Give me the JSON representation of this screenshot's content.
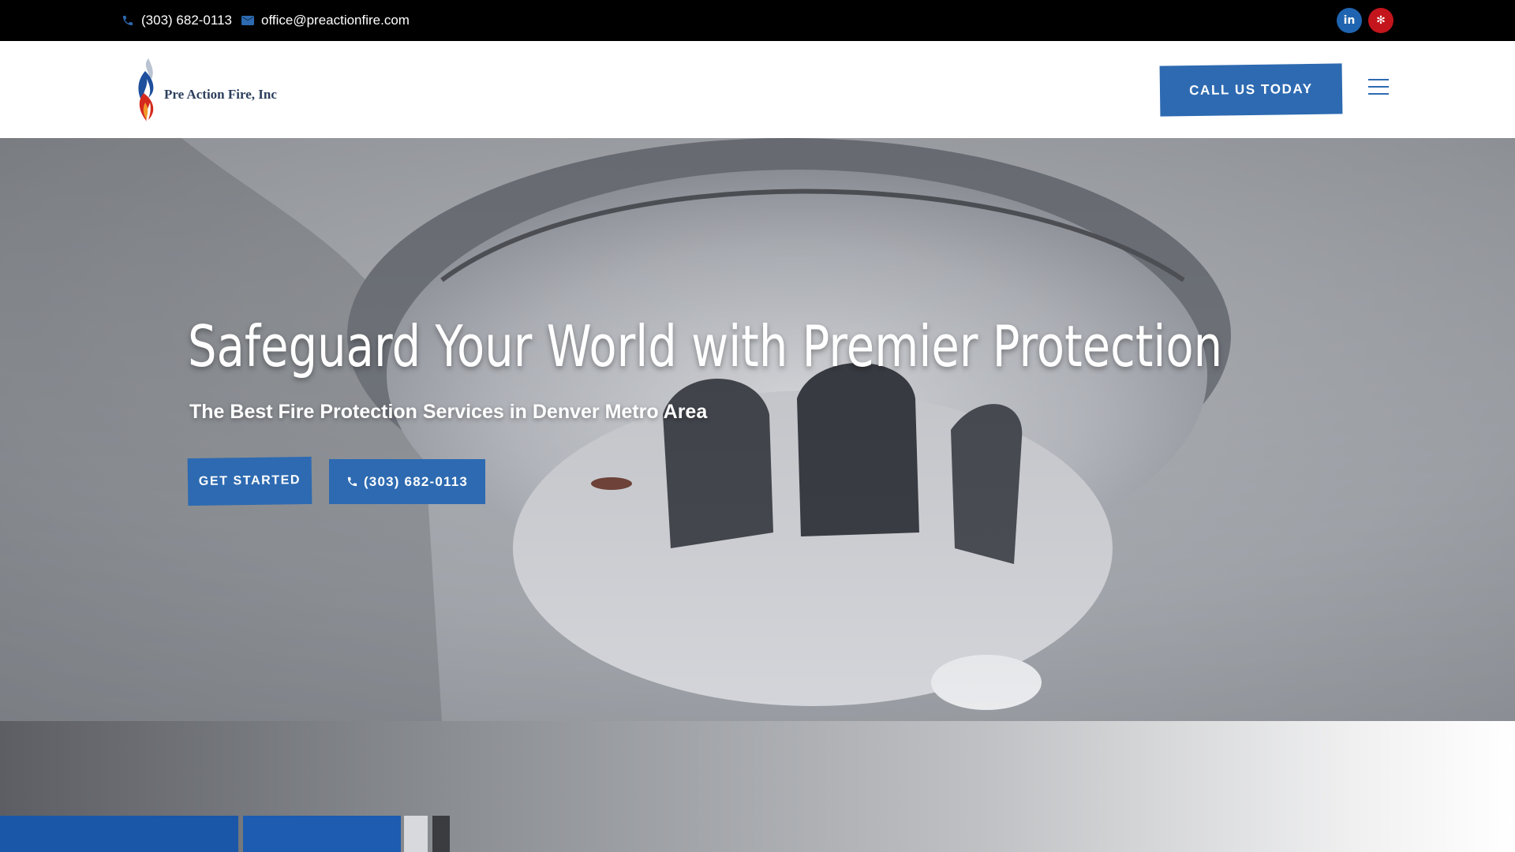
{
  "topbar": {
    "phone": "(303) 682-0113",
    "email": "office@preactionfire.com",
    "social": [
      {
        "name": "linkedin",
        "icon": "linkedin-icon",
        "glyph": "in",
        "color": "#1f64b0"
      },
      {
        "name": "yelp",
        "icon": "yelp-icon",
        "glyph": "✻",
        "color": "#c4151c"
      }
    ]
  },
  "header": {
    "logo_text": "Pre Action Fire, Inc",
    "cta_label": "CALL US TODAY",
    "menu_icon": "hamburger-menu-icon"
  },
  "hero": {
    "title": "Safeguard Your World with Premier Protection",
    "subtitle": "The Best Fire Protection Services in Denver Metro Area",
    "primary_button": "GET STARTED",
    "phone_button": "(303) 682-0113",
    "background": "smoke-detector-photo"
  },
  "colors": {
    "accent_blue": "#2d6ab1",
    "topbar_bg": "#000000",
    "yelp_red": "#c4151c"
  }
}
